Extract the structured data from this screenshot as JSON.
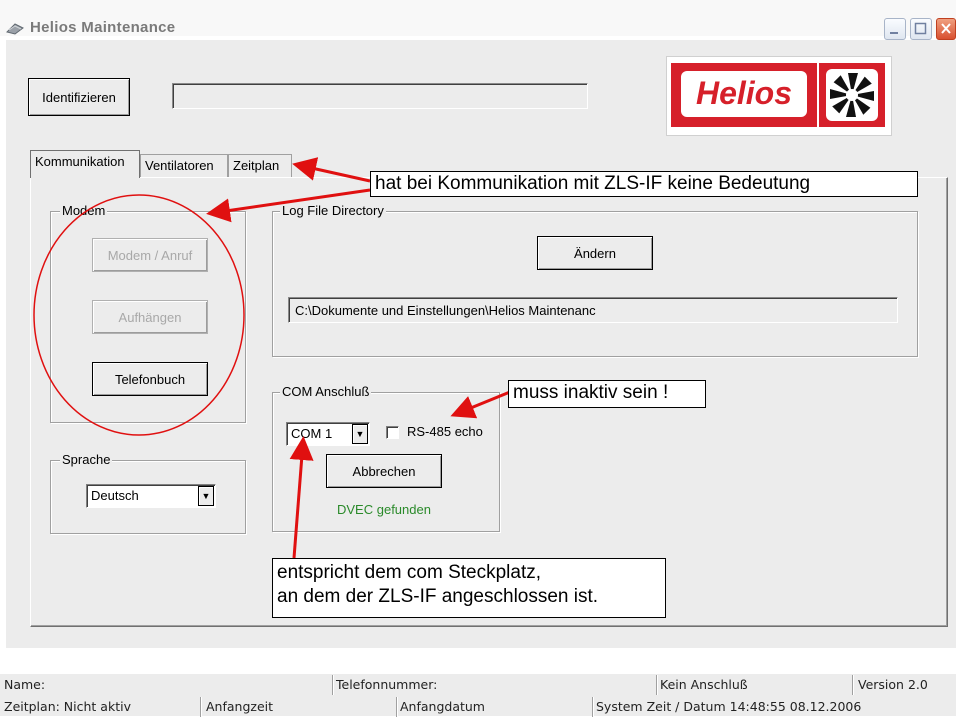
{
  "window": {
    "title": "Helios Maintenance"
  },
  "header": {
    "identify_label": "Identifizieren",
    "id_field_value": "",
    "logo_text": "Helios"
  },
  "tabs": [
    "Kommunikation",
    "Ventilatoren",
    "Zeitplan"
  ],
  "modem": {
    "label": "Modem",
    "call_button": "Modem / Anruf",
    "hangup_button": "Aufhängen",
    "phonebook_button": "Telefonbuch"
  },
  "language": {
    "label": "Sprache",
    "value": "Deutsch"
  },
  "logfile": {
    "label": "Log File Directory",
    "change_button": "Ändern",
    "path_value": "C:\\Dokumente und Einstellungen\\Helios Maintenanc"
  },
  "com": {
    "label": "COM Anschluß",
    "port_value": "COM 1",
    "rs485_label": "RS-485 echo",
    "rs485_checked": false,
    "cancel_button": "Abbrechen",
    "status_text": "DVEC gefunden",
    "status_color": "#2a8a2a"
  },
  "annotations": {
    "tabs_note": "hat bei Kommunikation mit ZLS-IF keine Bedeutung",
    "inactive_note": "muss inaktiv sein !",
    "slot_note_line1": "entspricht dem com Steckplatz,",
    "slot_note_line2": "an dem der ZLS-IF angeschlossen ist.",
    "arrow_color": "#e01010"
  },
  "statusbar": {
    "row1": {
      "name": "Name:",
      "phone": "Telefonnummer:",
      "connection": "Kein Anschluß",
      "version": "Version 2.0"
    },
    "row2": {
      "schedule": "Zeitplan: Nicht aktiv",
      "start_time": "Anfangzeit",
      "start_date": "Anfangdatum",
      "system_time": "System Zeit / Datum 14:48:55  08.12.2006"
    }
  },
  "colors": {
    "logo_red": "#d6202a",
    "panel": "#ececec"
  }
}
